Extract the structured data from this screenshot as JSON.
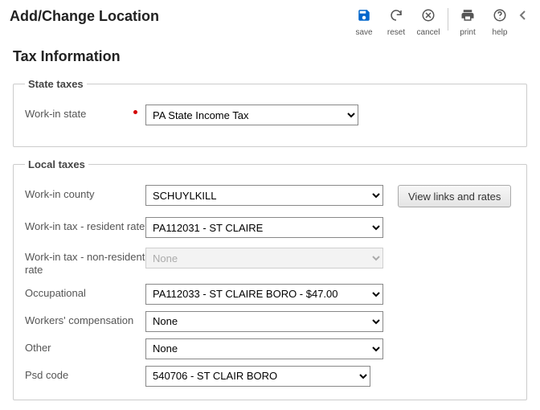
{
  "header": {
    "title": "Add/Change Location",
    "toolbar": {
      "save": "save",
      "reset": "reset",
      "cancel": "cancel",
      "print": "print",
      "help": "help"
    }
  },
  "section_title": "Tax Information",
  "state_taxes": {
    "legend": "State taxes",
    "work_in_state_label": "Work-in state",
    "work_in_state_value": "PA State Income Tax"
  },
  "local_taxes": {
    "legend": "Local taxes",
    "work_in_county_label": "Work-in county",
    "work_in_county_value": "SCHUYLKILL",
    "view_links_button": "View links and rates",
    "resident_rate_label": "Work-in tax - resident rate",
    "resident_rate_value": "PA112031 - ST CLAIRE",
    "nonresident_rate_label": "Work-in tax - non-resident rate",
    "nonresident_rate_value": "None",
    "occupational_label": "Occupational",
    "occupational_value": "PA112033 - ST CLAIRE BORO - $47.00",
    "workers_comp_label": "Workers' compensation",
    "workers_comp_value": "None",
    "other_label": "Other",
    "other_value": "None",
    "psd_label": "Psd code",
    "psd_value": "540706 - ST CLAIR BORO"
  }
}
